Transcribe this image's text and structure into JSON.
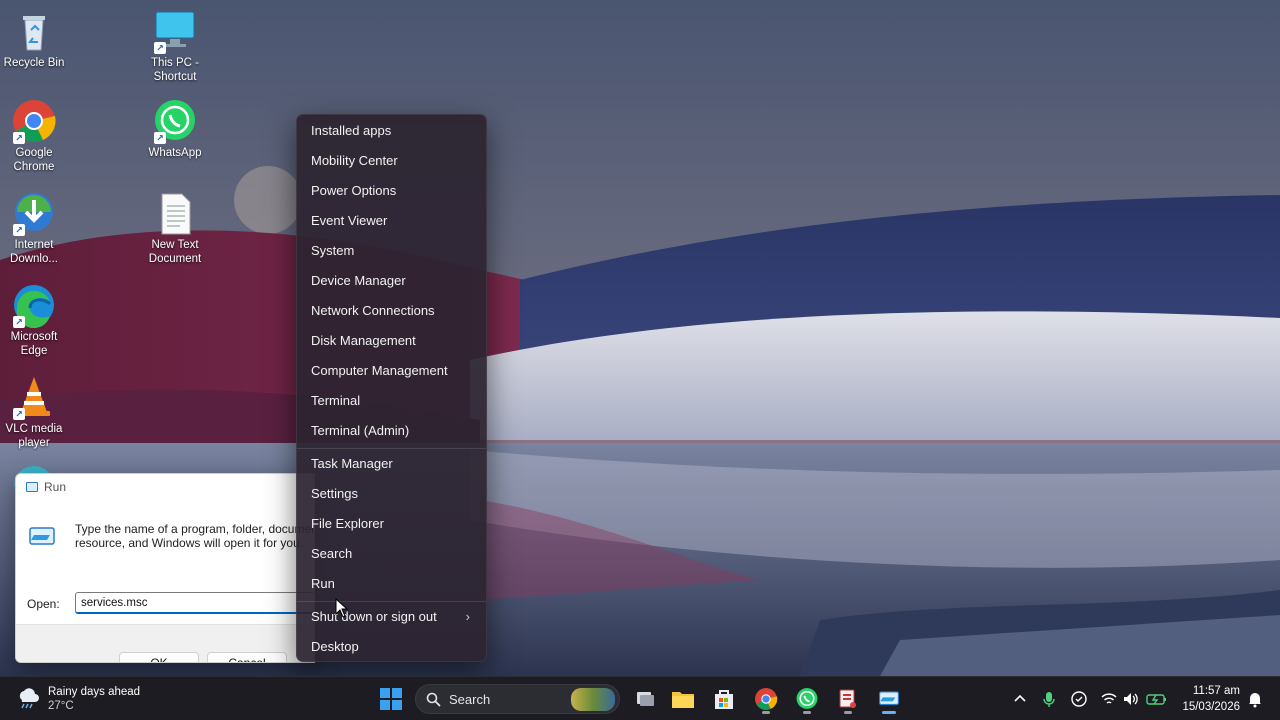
{
  "desktop": {
    "icons": [
      {
        "label": "Recycle Bin"
      },
      {
        "label": "This PC - Shortcut"
      },
      {
        "label": "Google Chrome"
      },
      {
        "label": "WhatsApp"
      },
      {
        "label": "Internet Downlo..."
      },
      {
        "label": "New Text Document"
      },
      {
        "label": "Microsoft Edge"
      },
      {
        "label": "VLC media player"
      }
    ]
  },
  "run_dialog": {
    "title": "Run",
    "description_line1": "Type the name of a program, folder, document, or Internet",
    "description_line2": "resource, and Windows will open it for you.",
    "open_label": "Open:",
    "input_value": "services.msc",
    "ok_label": "OK",
    "cancel_label": "Cancel"
  },
  "context_menu": {
    "items": [
      "Installed apps",
      "Mobility Center",
      "Power Options",
      "Event Viewer",
      "System",
      "Device Manager",
      "Network Connections",
      "Disk Management",
      "Computer Management",
      "Terminal",
      "Terminal (Admin)",
      "Task Manager",
      "Settings",
      "File Explorer",
      "Search",
      "Run",
      "Shut down or sign out",
      "Desktop"
    ]
  },
  "taskbar": {
    "weather_title": "Rainy days ahead",
    "weather_temp": "27°C",
    "search_label": "Search",
    "time": "11:57 am",
    "date": "15/03/2026"
  }
}
